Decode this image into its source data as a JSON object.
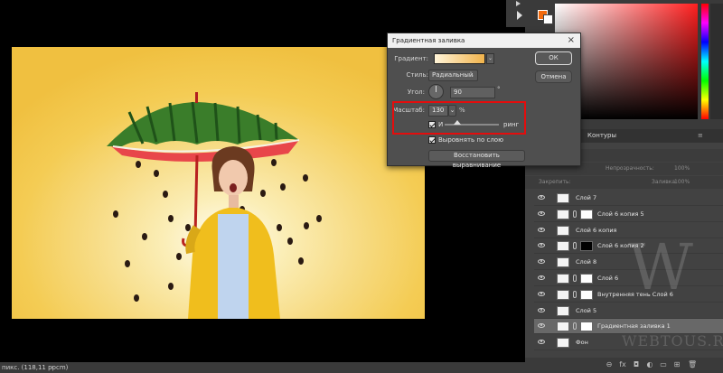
{
  "status": {
    "text": "пикс. (118,11 ppcm)",
    "arrow": "›"
  },
  "dialog": {
    "title": "Градиентная заливка",
    "close": "×",
    "gradient_label": "Градиент:",
    "style_label": "Стиль:",
    "style_value": "Радиальный",
    "angle_label": "Угол:",
    "angle_value": "90",
    "degree": "°",
    "scale_label": "Масштаб:",
    "scale_value": "130",
    "percent": "%",
    "reverse_label": "И",
    "dither_label": "ринг",
    "align_label": "Выровнять по слою",
    "reset_button": "Восстановить выравнивание",
    "ok_button": "ОК",
    "cancel_button": "Отмена",
    "chevron": "⌄"
  },
  "colors": {
    "foreground": "#f26a0d",
    "background": "#ffffff",
    "highlight": "#e30d0d"
  },
  "panels": {
    "tab_contours": "Контуры",
    "opacity_label": "Непрозрачность:",
    "opacity_value": "100%",
    "lock_label": "Закрепить:",
    "fill_label": "Заливка:",
    "fill_value": "100%"
  },
  "layers": [
    {
      "name": "Слой 7",
      "chain": false,
      "mask": "none",
      "selected": false
    },
    {
      "name": "Слой 6 копия 5",
      "chain": true,
      "mask": "white",
      "selected": false
    },
    {
      "name": "Слой 6 копия",
      "chain": false,
      "mask": "none",
      "selected": false
    },
    {
      "name": "Слой 6 копия 2",
      "chain": true,
      "mask": "black",
      "selected": false
    },
    {
      "name": "Слой 8",
      "chain": false,
      "mask": "none",
      "selected": false
    },
    {
      "name": "Слой 6",
      "chain": true,
      "mask": "white",
      "selected": false
    },
    {
      "name": "Внутренняя тень Слой 6",
      "chain": true,
      "mask": "white",
      "selected": false
    },
    {
      "name": "Слой 5",
      "chain": false,
      "mask": "none",
      "selected": false
    },
    {
      "name": "Градиентная заливка 1",
      "chain": true,
      "mask": "white",
      "selected": true
    },
    {
      "name": "Фон",
      "chain": false,
      "mask": "none",
      "selected": false
    }
  ],
  "bottom_icons": [
    "link-icon",
    "fx-icon",
    "mask-icon",
    "adjustment-icon",
    "group-icon",
    "new-layer-icon",
    "trash-icon"
  ],
  "bottom_glyphs": [
    "⊖",
    "fx",
    "◘",
    "◐",
    "▭",
    "⊞",
    "🗑"
  ],
  "watermark": {
    "letter": "W",
    "text": "WEBTOUS.RU"
  }
}
